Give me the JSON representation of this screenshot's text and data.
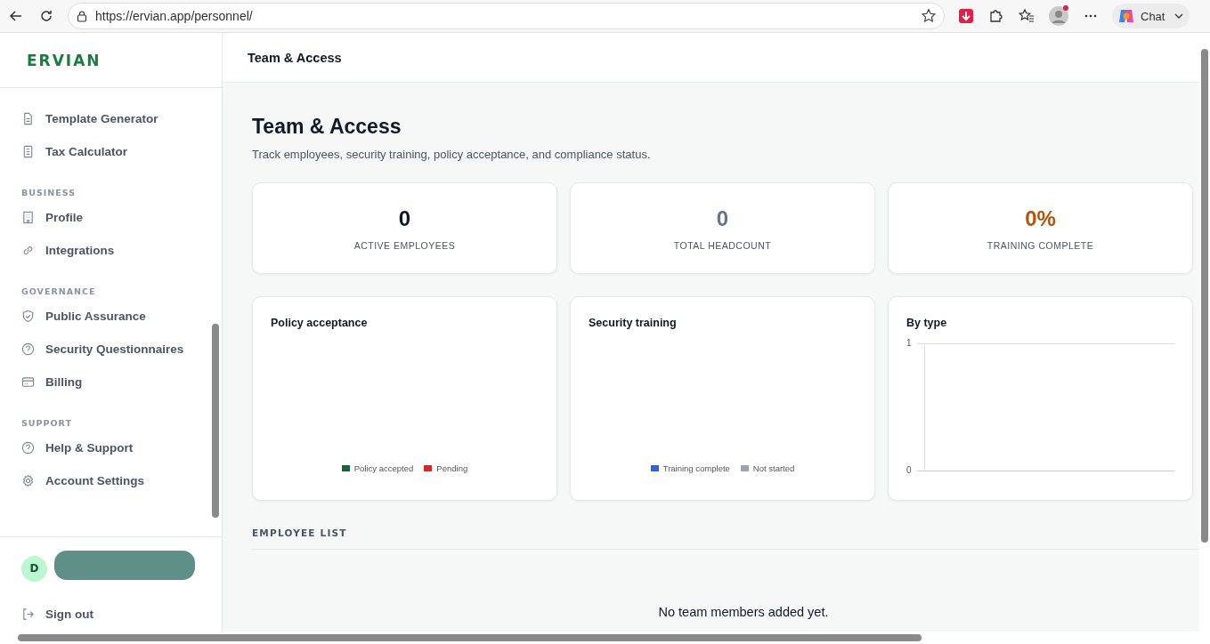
{
  "browser": {
    "url": "https://ervian.app/personnel/",
    "chat_label": "Chat"
  },
  "sidebar": {
    "logo": "ERVIAN",
    "sections": [
      {
        "items": [
          {
            "label": "Template Generator",
            "selected": false
          },
          {
            "label": "Tax Calculator",
            "selected": false
          }
        ]
      },
      {
        "label": "BUSINESS",
        "items": [
          {
            "label": "Profile",
            "selected": false
          },
          {
            "label": "Integrations",
            "selected": false
          }
        ]
      },
      {
        "label": "GOVERNANCE",
        "items": [
          {
            "label": "Public Assurance",
            "selected": false
          },
          {
            "label": "Security Questionnaires",
            "selected": false
          },
          {
            "label": "Billing",
            "selected": false
          }
        ]
      },
      {
        "label": "SUPPORT",
        "items": [
          {
            "label": "Help & Support",
            "selected": false
          },
          {
            "label": "Account Settings",
            "selected": false
          }
        ]
      }
    ],
    "user": {
      "initial": "D"
    },
    "sign_out": "Sign out"
  },
  "header": {
    "title": "Team & Access"
  },
  "page": {
    "title": "Team & Access",
    "subtitle": "Track employees, security training, policy acceptance, and compliance status."
  },
  "stats": [
    {
      "value": "0",
      "label": "ACTIVE EMPLOYEES",
      "color": "#0f172a"
    },
    {
      "value": "0",
      "label": "TOTAL HEADCOUNT",
      "color": "#64748b"
    },
    {
      "value": "0%",
      "label": "TRAINING COMPLETE",
      "color": "#b45309"
    }
  ],
  "charts": [
    {
      "kind": "donut",
      "title": "Policy acceptance",
      "legend": [
        {
          "label": "Policy accepted",
          "color": "#166534"
        },
        {
          "label": "Pending",
          "color": "#dc2626"
        }
      ]
    },
    {
      "kind": "donut",
      "title": "Security training",
      "legend": [
        {
          "label": "Training complete",
          "color": "#2563eb"
        },
        {
          "label": "Not started",
          "color": "#9ca3af"
        }
      ]
    },
    {
      "kind": "axes",
      "title": "By type",
      "axis_labels": [
        "1",
        "0"
      ]
    }
  ],
  "employee_list": {
    "heading": "EMPLOYEE LIST",
    "empty_text": "No team members added yet."
  }
}
